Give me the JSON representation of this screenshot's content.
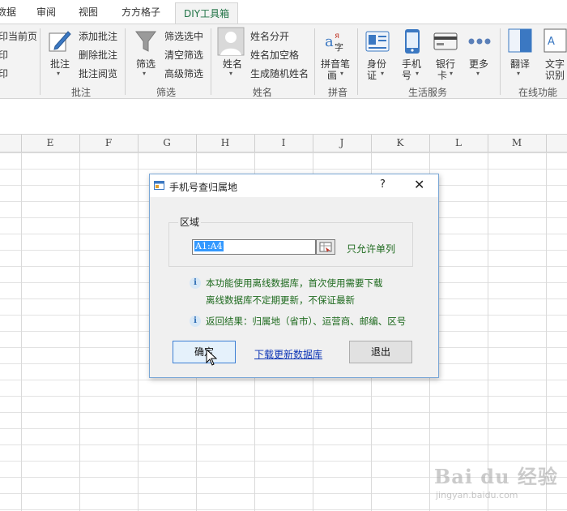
{
  "tabs": [
    "数据",
    "审阅",
    "视图",
    "方方格子",
    "DIY工具箱"
  ],
  "ribbon": {
    "print": {
      "items": [
        "打印当前页",
        "打印",
        "打印"
      ]
    },
    "comment": {
      "big_label": "批注",
      "items": [
        "添加批注",
        "删除批注",
        "批注阅览"
      ],
      "group": "批注"
    },
    "filter": {
      "big_label": "筛选",
      "items": [
        "筛选选中",
        "清空筛选",
        "高级筛选"
      ],
      "group": "筛选"
    },
    "name": {
      "big_label": "姓名",
      "items": [
        "姓名分开",
        "姓名加空格",
        "生成随机姓名"
      ],
      "group": "姓名"
    },
    "pinyin": {
      "big_label_1": "拼音笔",
      "big_label_2": "画",
      "group": "拼音"
    },
    "life": {
      "group": "生活服务",
      "items": [
        {
          "l1": "身份",
          "l2": "证"
        },
        {
          "l1": "手机",
          "l2": "号"
        },
        {
          "l1": "银行",
          "l2": "卡"
        },
        {
          "l1": "更多",
          "l2": ""
        }
      ]
    },
    "online": {
      "group": "在线功能",
      "translate": "翻译",
      "ocr_1": "文字",
      "ocr_2": "识别"
    }
  },
  "columns": [
    "E",
    "F",
    "G",
    "H",
    "I",
    "J",
    "K",
    "L",
    "M"
  ],
  "dialog": {
    "title": "手机号查归属地",
    "help": "?",
    "close": "✕",
    "legend": "区域",
    "range_value": "A1:A4",
    "only_single_col": "只允许单列",
    "info1_line1": "本功能使用离线数据库，首次使用需要下载",
    "info1_line2": "离线数据库不定期更新，不保证最新",
    "info2": "返回结果：归属地（省市）、运营商、邮编、区号",
    "ok": "确定",
    "download_link": "下载更新数据库",
    "exit": "退出"
  },
  "watermark": {
    "main": "Bai du 经验",
    "sub": "jingyan.baidu.com"
  },
  "colors": {
    "excel_green": "#217346",
    "link_blue": "#0b33b5",
    "info_green": "#1e6a1e"
  }
}
